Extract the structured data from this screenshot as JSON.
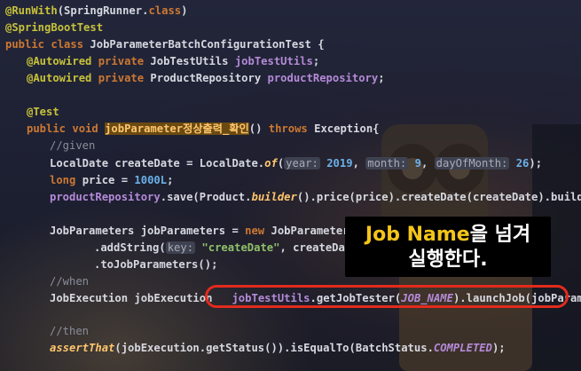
{
  "code": {
    "l1": {
      "a": "@RunWith",
      "b": "(SpringRunner.",
      "c": "class",
      "d": ")"
    },
    "l2": {
      "a": "@SpringBootTest"
    },
    "l3": {
      "kw": "public class ",
      "name": "JobParameterBatchConfigurationTest {"
    },
    "l4": {
      "ann": "@Autowired ",
      "kw": "private ",
      "type": "JobTestUtils ",
      "field": "jobTestUtils",
      "end": ";"
    },
    "l5": {
      "ann": "@Autowired ",
      "kw": "private ",
      "type": "ProductRepository ",
      "field": "productRepository",
      "end": ";"
    },
    "l6": {
      "ann": "@Test"
    },
    "l7": {
      "kw": "public void ",
      "method": "jobParameter정상출력_확인",
      "mid": "() ",
      "kw2": "throws ",
      "end": "Exception{"
    },
    "l8": {
      "c": "//given"
    },
    "l9": {
      "a": "LocalDate createDate = LocalDate.",
      "fn": "of",
      "b": "(",
      "h1": "year:",
      "n1": "2019",
      "c": ", ",
      "h2": "month:",
      "n2": "9",
      "d": ", ",
      "h3": "dayOfMonth:",
      "n3": "26",
      "e": ");"
    },
    "l10": {
      "kw": "long ",
      "a": "price = ",
      "n": "1000L",
      "e": ";"
    },
    "l11": {
      "f": "productRepository",
      "a": ".save(Product.",
      "fn": "builder",
      "b": "().price(price).createDate(createDate).build());"
    },
    "l12": {
      "a": "JobParameters jobParameters = ",
      "kw": "new ",
      "b": "JobParametersBuil"
    },
    "l13": {
      "a": ".addString(",
      "h": "key:",
      "s": "\"createDate\"",
      "b": ", createDate.to"
    },
    "l14": {
      "a": ".toJobParameters();"
    },
    "l15": {
      "c": "//when"
    },
    "l16": {
      "a": "JobExecution jobExecution ",
      "f": "jobTestUtils",
      "b": ".getJobTester(",
      "k": "JOB_NAME",
      "c": ").launchJob(jobParameters);"
    },
    "l17": {
      "c": "//then"
    },
    "l18": {
      "fn": "assertThat",
      "a": "(jobExecution.getStatus()).isEqualTo(BatchStatus.",
      "k": "COMPLETED",
      "b": ");"
    }
  },
  "caption": {
    "line1_highlight": "Job Name",
    "line1_rest": "을 넘겨",
    "line2": "실행한다."
  }
}
